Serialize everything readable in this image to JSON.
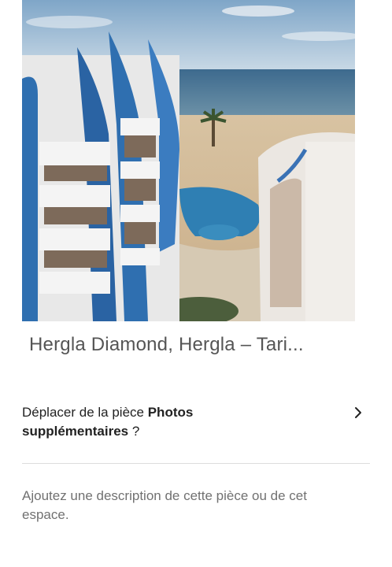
{
  "photo": {
    "caption": "Hergla Diamond, Hergla – Tari..."
  },
  "move_row": {
    "prefix": "Déplacer de la pièce ",
    "target": "Photos supplémentaires",
    "suffix": " ?",
    "chevron_icon": "chevron-right-icon"
  },
  "description": {
    "placeholder": "Ajoutez une description de cette pièce ou de cet espace."
  },
  "colors": {
    "primary_text": "#222222",
    "secondary_text": "#717171",
    "caption_text": "#555555",
    "divider": "#dddddd"
  }
}
